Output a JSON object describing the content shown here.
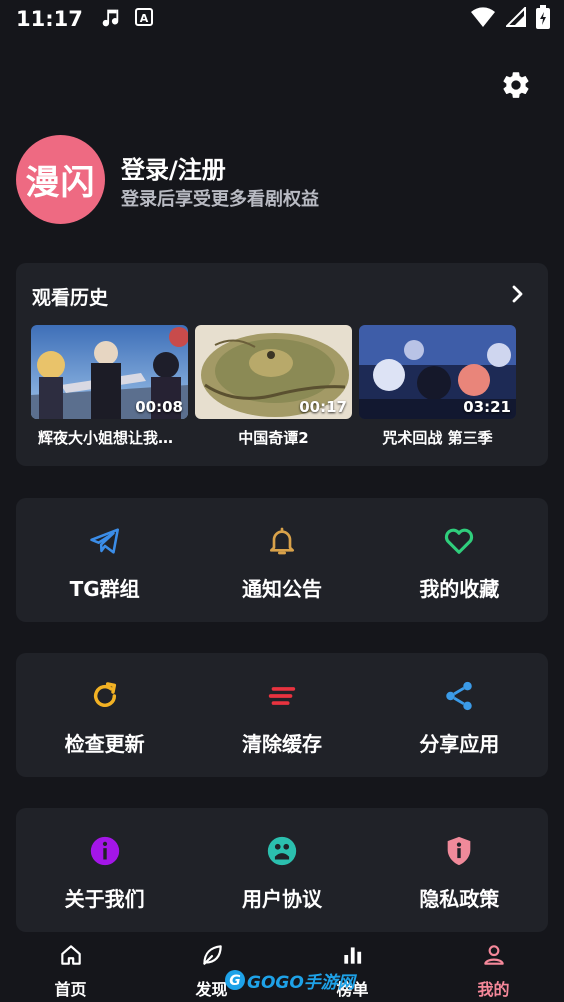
{
  "status_bar": {
    "time": "11:17",
    "icons": [
      "music-note-icon",
      "keyboard-a-icon",
      "wifi-icon",
      "signal-icon",
      "battery-icon"
    ]
  },
  "profile": {
    "avatar_text": "漫闪",
    "login_title": "登录/注册",
    "login_subtitle": "登录后享受更多看剧权益"
  },
  "history": {
    "title": "观看历史",
    "items": [
      {
        "name": "辉夜大小姐想让我…",
        "duration": "00:08"
      },
      {
        "name": "中国奇谭2",
        "duration": "00:17"
      },
      {
        "name": "咒术回战 第三季",
        "duration": "03:21"
      }
    ]
  },
  "actions": {
    "row1": [
      {
        "label": "TG群组",
        "icon": "telegram-icon",
        "color": "#3b8de8"
      },
      {
        "label": "通知公告",
        "icon": "bell-icon",
        "color": "#d9a24a"
      },
      {
        "label": "我的收藏",
        "icon": "heart-icon",
        "color": "#2fce7c"
      }
    ],
    "row2": [
      {
        "label": "检查更新",
        "icon": "refresh-icon",
        "color": "#f2b224"
      },
      {
        "label": "清除缓存",
        "icon": "clear-cache-icon",
        "color": "#e8333f"
      },
      {
        "label": "分享应用",
        "icon": "share-icon",
        "color": "#3b9be8"
      }
    ],
    "row3": [
      {
        "label": "关于我们",
        "icon": "info-icon",
        "color": "#a416e8"
      },
      {
        "label": "用户协议",
        "icon": "agreement-icon",
        "color": "#2bbfae"
      },
      {
        "label": "隐私政策",
        "icon": "privacy-shield-icon",
        "color": "#f08a9a"
      }
    ]
  },
  "bottom_nav": {
    "items": [
      {
        "label": "首页",
        "icon": "home-icon"
      },
      {
        "label": "发现",
        "icon": "leaf-icon"
      },
      {
        "label": "榜单",
        "icon": "bar-chart-icon"
      },
      {
        "label": "我的",
        "icon": "user-icon",
        "active": true
      }
    ],
    "active_color": "#f5889a"
  },
  "watermark": "GOGO手游网"
}
